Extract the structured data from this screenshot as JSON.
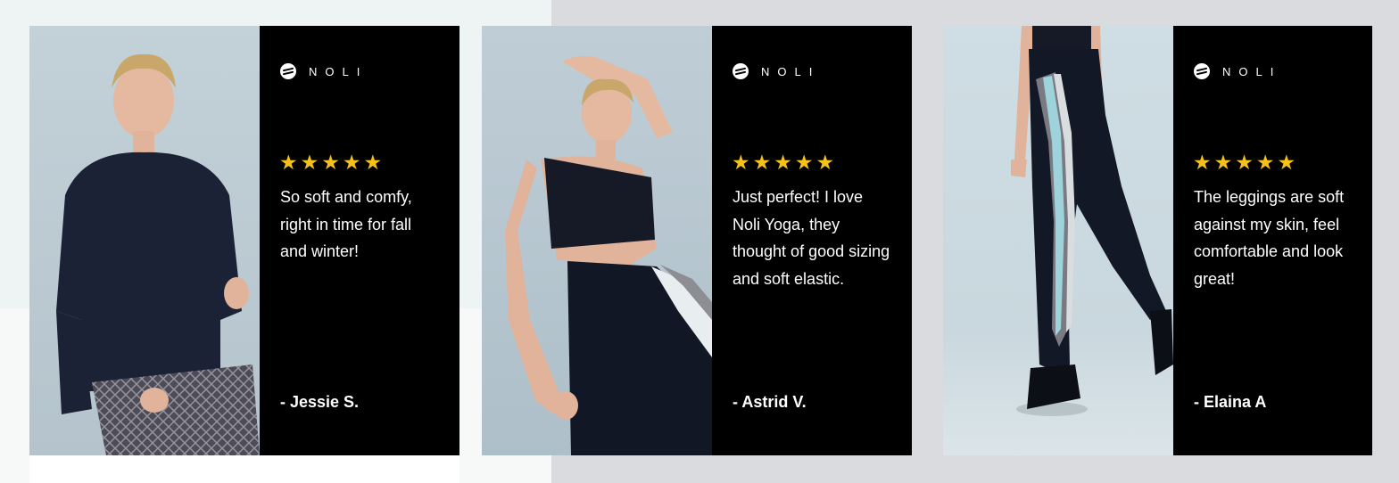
{
  "brand": {
    "name": "NOLI",
    "logo_icon": "noli-logo-icon"
  },
  "star_color": "#f6c21a",
  "reviews": [
    {
      "rating": 5,
      "stars": [
        "★",
        "★",
        "★",
        "★",
        "★"
      ],
      "text": "So soft and comfy, right in time for fall and winter!",
      "author": "- Jessie S."
    },
    {
      "rating": 5,
      "stars": [
        "★",
        "★",
        "★",
        "★",
        "★"
      ],
      "text": "Just perfect! I love Noli Yoga, they thought of good sizing and soft elastic.",
      "author": "- Astrid V."
    },
    {
      "rating": 5,
      "stars": [
        "★",
        "★",
        "★",
        "★",
        "★"
      ],
      "text": "The leggings are soft against my skin, feel comfortable and look great!",
      "author": "- Elaina A"
    }
  ]
}
